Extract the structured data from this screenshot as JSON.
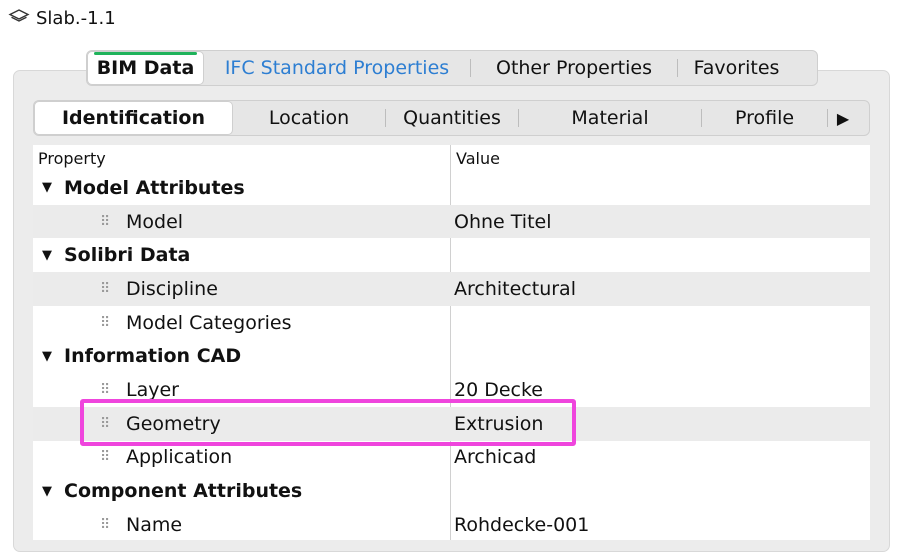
{
  "window": {
    "title": "Slab.-1.1",
    "icon": "layers-icon"
  },
  "top_tabs": [
    {
      "label": "BIM Data",
      "active": true
    },
    {
      "label": "IFC Standard Properties",
      "active": false,
      "link": true
    },
    {
      "label": "Other Properties",
      "active": false
    },
    {
      "label": "Favorites",
      "active": false
    }
  ],
  "sub_tabs": [
    {
      "label": "Identification",
      "active": true
    },
    {
      "label": "Location"
    },
    {
      "label": "Quantities"
    },
    {
      "label": "Material"
    },
    {
      "label": "Profile"
    }
  ],
  "sub_tabs_more": "▶",
  "table": {
    "headers": {
      "property": "Property",
      "value": "Value"
    },
    "rows": [
      {
        "type": "group",
        "label": "Model Attributes"
      },
      {
        "type": "item",
        "label": "Model",
        "value": "Ohne Titel"
      },
      {
        "type": "group",
        "label": "Solibri Data"
      },
      {
        "type": "item",
        "label": "Discipline",
        "value": "Architectural"
      },
      {
        "type": "item",
        "label": "Model Categories",
        "value": ""
      },
      {
        "type": "group",
        "label": "Information CAD"
      },
      {
        "type": "item",
        "label": "Layer",
        "value": "20 Decke"
      },
      {
        "type": "item",
        "label": "Geometry",
        "value": "Extrusion"
      },
      {
        "type": "item",
        "label": "Application",
        "value": "Archicad"
      },
      {
        "type": "group",
        "label": "Component Attributes"
      },
      {
        "type": "item",
        "label": "Name",
        "value": "Rohdecke-001"
      }
    ]
  },
  "colors": {
    "highlight": "#ef45dd",
    "active_tab_indicator": "#1fb35b",
    "link": "#2d7ed2"
  }
}
